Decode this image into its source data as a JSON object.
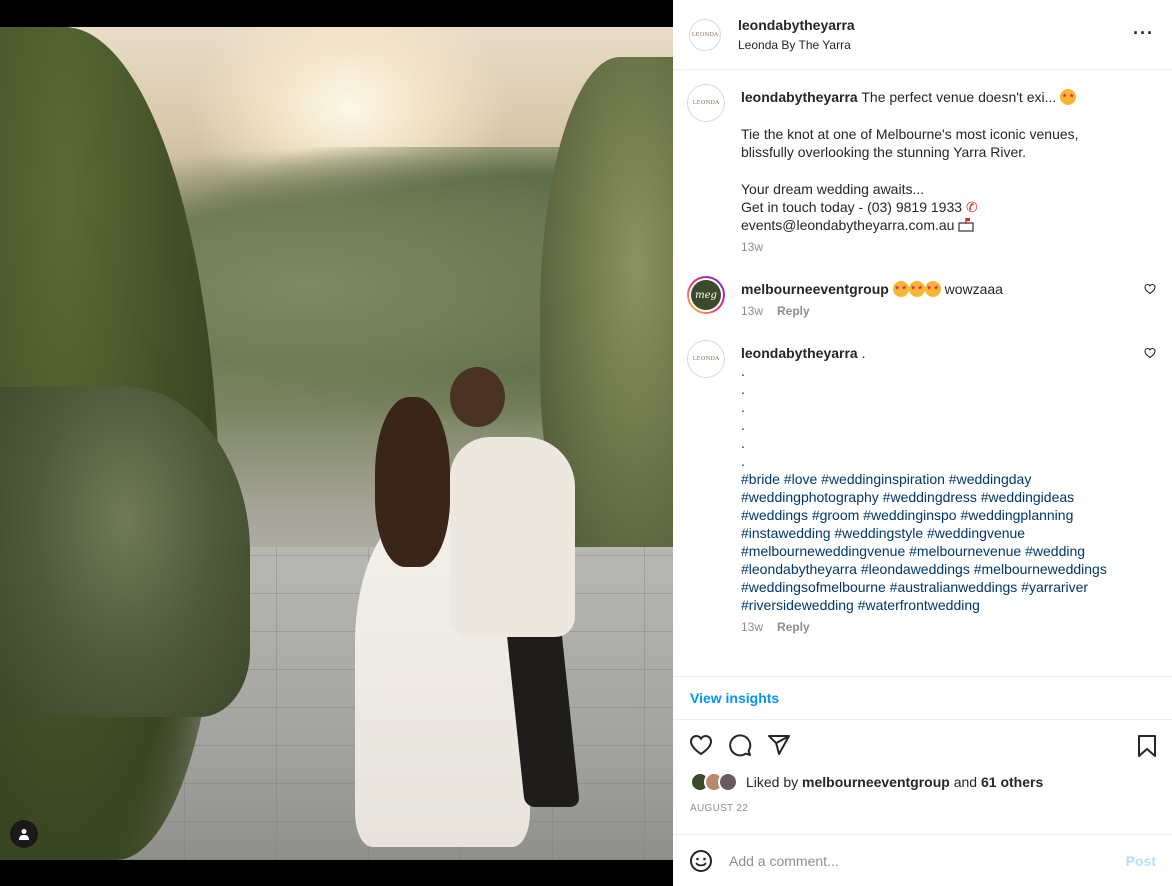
{
  "post": {
    "username": "leondabytheyarra",
    "location": "Leonda By The Yarra",
    "avatar_logo_text": "LEONDA"
  },
  "caption": {
    "username": "leondabytheyarra",
    "lead": "The perfect venue doesn't exi...",
    "para1": "Tie the knot at one of Melbourne's most iconic venues, blissfully overlooking the stunning Yarra River.",
    "line1": "Your dream wedding awaits...",
    "line2": "Get in touch today - (03) 9819 1933",
    "line3": "events@leondabytheyarra.com.au",
    "time": "13w"
  },
  "comments": [
    {
      "username": "melbourneeventgroup",
      "avatar_text": "meg",
      "text": "wowzaaa",
      "time": "13w",
      "reply_label": "Reply"
    },
    {
      "username": "leondabytheyarra",
      "lead": ".",
      "dots": [
        ".",
        ".",
        ".",
        ".",
        ".",
        "."
      ],
      "hashtags": "#bride #love #weddinginspiration #weddingday #weddingphotography #weddingdress #weddingideas #weddings #groom #weddinginspo #weddingplanning #instawedding #weddingstyle #weddingvenue #melbourneweddingvenue #melbournevenue #wedding #leondabytheyarra #leondaweddings #melbourneweddings #weddingsofmelbourne #australianweddings #yarrariver #riversidewedding #waterfrontwedding",
      "time": "13w",
      "reply_label": "Reply"
    }
  ],
  "insights_label": "View insights",
  "likes": {
    "prefix": "Liked by",
    "user": "melbourneeventgroup",
    "joiner": "and",
    "others": "61 others"
  },
  "date": "AUGUST 22",
  "add_comment": {
    "placeholder": "Add a comment...",
    "post_label": "Post"
  },
  "icons": {
    "more": "more-horizontal-icon",
    "like": "heart-icon",
    "comment": "comment-icon",
    "share": "share-icon",
    "save": "bookmark-icon",
    "emoji": "emoji-icon",
    "user_tag": "user-tag-icon"
  },
  "colors": {
    "link": "#00376b",
    "accent": "#0095f6",
    "muted": "#8e8e8e"
  }
}
